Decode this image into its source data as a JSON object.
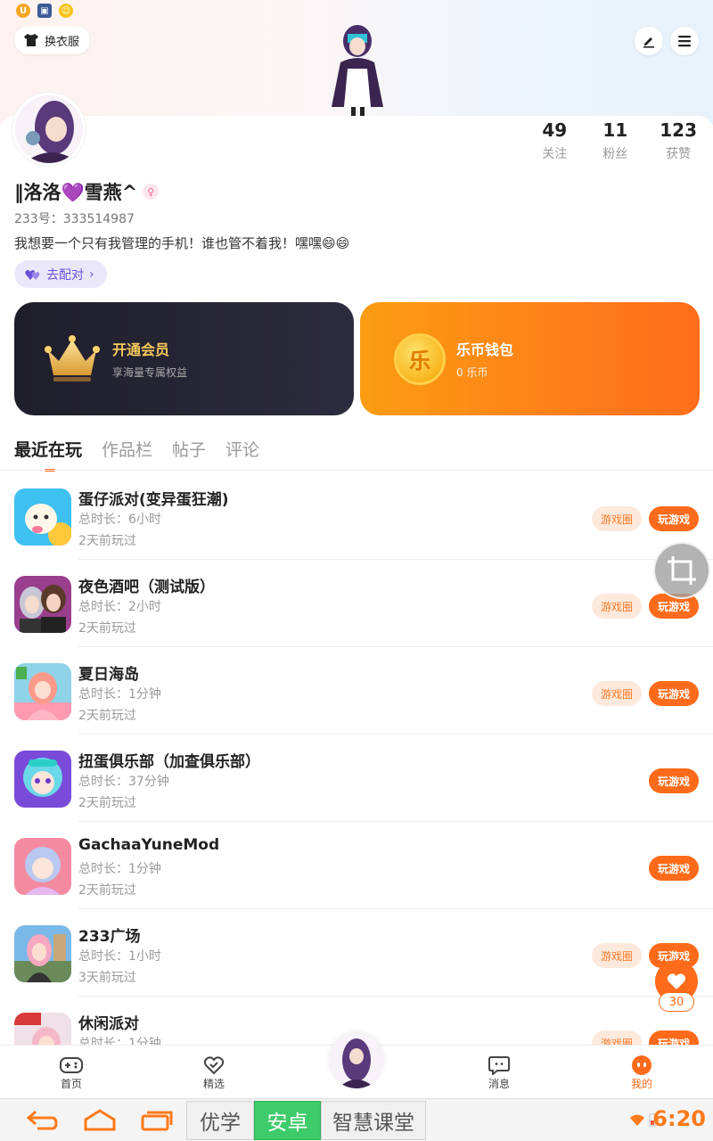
{
  "header": {
    "dress_label": "换衣服"
  },
  "profile": {
    "name": "‖洛洛💜雪燕^",
    "gender_symbol": "♀",
    "uid": "233号：333514987",
    "bio": "我想要一个只有我管理的手机！谁也管不着我！嘿嘿😄😄",
    "match_label": "去配对",
    "stats": [
      {
        "num": "49",
        "label": "关注"
      },
      {
        "num": "11",
        "label": "粉丝"
      },
      {
        "num": "123",
        "label": "获赞"
      }
    ]
  },
  "promos": {
    "vip_title": "开通会员",
    "vip_sub": "享海量专属权益",
    "wallet_title": "乐币钱包",
    "wallet_sub": "0 乐币",
    "wallet_coin_char": "乐"
  },
  "tabs": [
    "最近在玩",
    "作品栏",
    "帖子",
    "评论"
  ],
  "games": [
    {
      "name": "蛋仔派对(变异蛋狂潮)",
      "duration": "总时长：6小时",
      "last": "2天前玩过",
      "circle": "游戏圈",
      "play": "玩游戏",
      "has_circle": true
    },
    {
      "name": "夜色酒吧（测试版）",
      "duration": "总时长：2小时",
      "last": "2天前玩过",
      "circle": "游戏圈",
      "play": "玩游戏",
      "has_circle": true
    },
    {
      "name": "夏日海岛",
      "duration": "总时长：1分钟",
      "last": "2天前玩过",
      "circle": "游戏圈",
      "play": "玩游戏",
      "has_circle": true
    },
    {
      "name": "扭蛋俱乐部（加查俱乐部）",
      "duration": "总时长：37分钟",
      "last": "2天前玩过",
      "circle": "",
      "play": "玩游戏",
      "has_circle": false
    },
    {
      "name": "GachaaYuneMod",
      "duration": "总时长：1分钟",
      "last": "2天前玩过",
      "circle": "",
      "play": "玩游戏",
      "has_circle": false
    },
    {
      "name": "233广场",
      "duration": "总时长：1小时",
      "last": "3天前玩过",
      "circle": "游戏圈",
      "play": "玩游戏",
      "has_circle": true
    },
    {
      "name": "休闲派对",
      "duration": "总时长：1分钟",
      "last": "",
      "circle": "游戏圈",
      "play": "玩游戏",
      "has_circle": true
    }
  ],
  "like_count": "30",
  "bottom_nav": {
    "home": "首页",
    "featured": "精选",
    "messages": "消息",
    "mine": "我的"
  },
  "system_bar": {
    "tab1": "优学",
    "tab2": "安卓",
    "tab3": "智慧课堂",
    "time": "6:20"
  },
  "colors": {
    "accent": "#ff6b1a",
    "vip_gold": "#f5c95a",
    "match_purple": "#6a52d8"
  }
}
